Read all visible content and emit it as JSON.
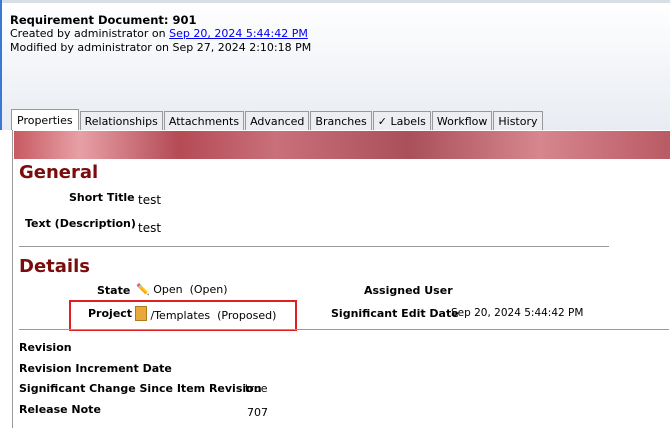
{
  "header": {
    "title": "Requirement Document:  901",
    "created_prefix": "Created by administrator on ",
    "created_date": "Sep 20, 2024 5:44:42 PM",
    "modified": "Modified by administrator on Sep 27, 2024 2:10:18 PM"
  },
  "tabs": [
    "Properties",
    "Relationships",
    "Attachments",
    "Advanced",
    "Branches",
    "✓ Labels",
    "Workflow",
    "History"
  ],
  "general": {
    "heading": "General",
    "short_title_label": "Short Title",
    "short_title": "test",
    "text_label": "Text (Description)",
    "text": "test"
  },
  "details": {
    "heading": "Details",
    "state_label": "State",
    "state": "Open",
    "state_paren": "(Open)",
    "project_label": "Project",
    "project": "/Templates",
    "project_paren": "(Proposed)",
    "assigned_user_label": "Assigned User",
    "sig_edit_label": "Significant Edit Date",
    "sig_edit": "Sep 20, 2024 5:44:42 PM",
    "revision_label": "Revision",
    "rev_inc_label": "Revision Increment Date",
    "sig_change_label": "Significant Change Since Item Revision",
    "sig_change": "true",
    "release_note_label": "Release Note",
    "release_note": "707"
  }
}
